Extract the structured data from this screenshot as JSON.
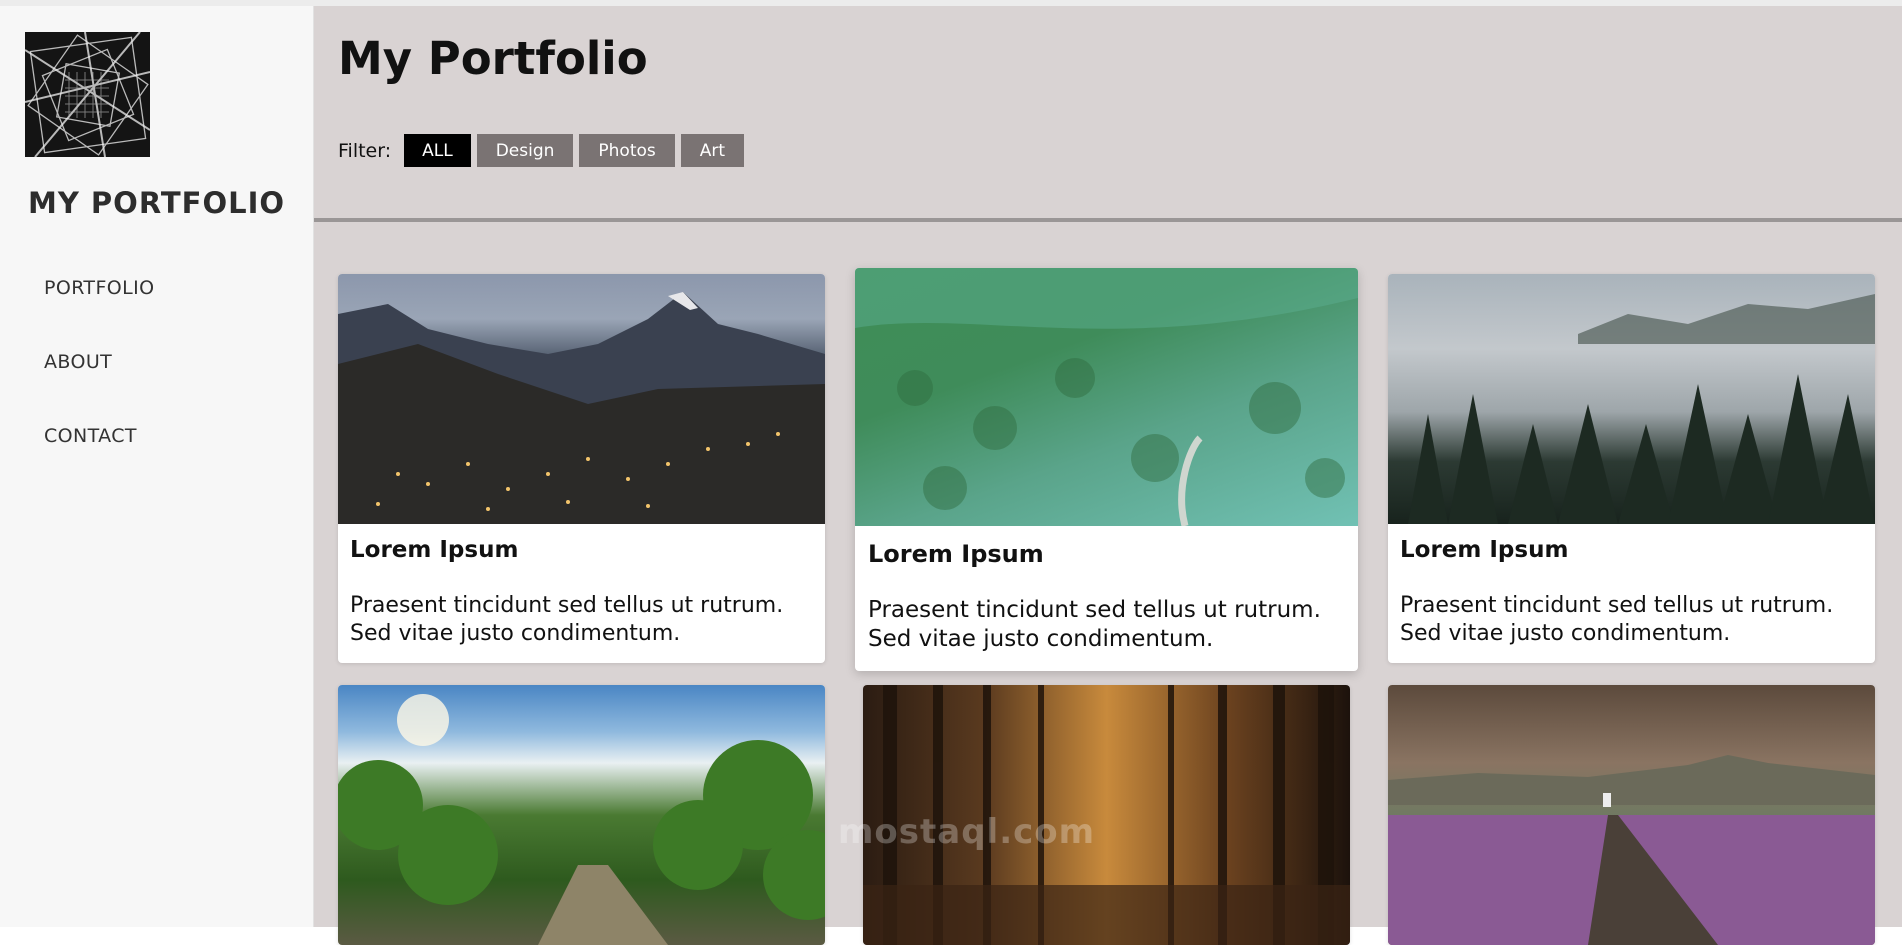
{
  "sidebar": {
    "brand": "MY PORTFOLIO",
    "nav": [
      {
        "label": "PORTFOLIO"
      },
      {
        "label": "ABOUT"
      },
      {
        "label": "CONTACT"
      }
    ]
  },
  "main": {
    "title": "My Portfolio",
    "filter": {
      "label": "Filter:",
      "buttons": [
        {
          "label": "ALL",
          "active": true
        },
        {
          "label": "Design"
        },
        {
          "label": "Photos"
        },
        {
          "label": "Art"
        }
      ]
    },
    "cards": [
      {
        "title": "Lorem Ipsum",
        "text": "Praesent tincidunt sed tellus ut rutrum. Sed vitae justo condimentum."
      },
      {
        "title": "Lorem Ipsum",
        "text": "Praesent tincidunt sed tellus ut rutrum. Sed vitae justo condimentum."
      },
      {
        "title": "Lorem Ipsum",
        "text": "Praesent tincidunt sed tellus ut rutrum. Sed vitae justo condimentum."
      },
      {
        "title": "",
        "text": ""
      },
      {
        "title": "",
        "text": ""
      },
      {
        "title": "",
        "text": ""
      }
    ]
  },
  "watermark": "mostaql.com",
  "colors": {
    "sidebar_bg": "#f7f7f7",
    "main_bg": "#d9d3d3",
    "filter_active": "#000000",
    "filter_inactive": "#7a7373"
  }
}
